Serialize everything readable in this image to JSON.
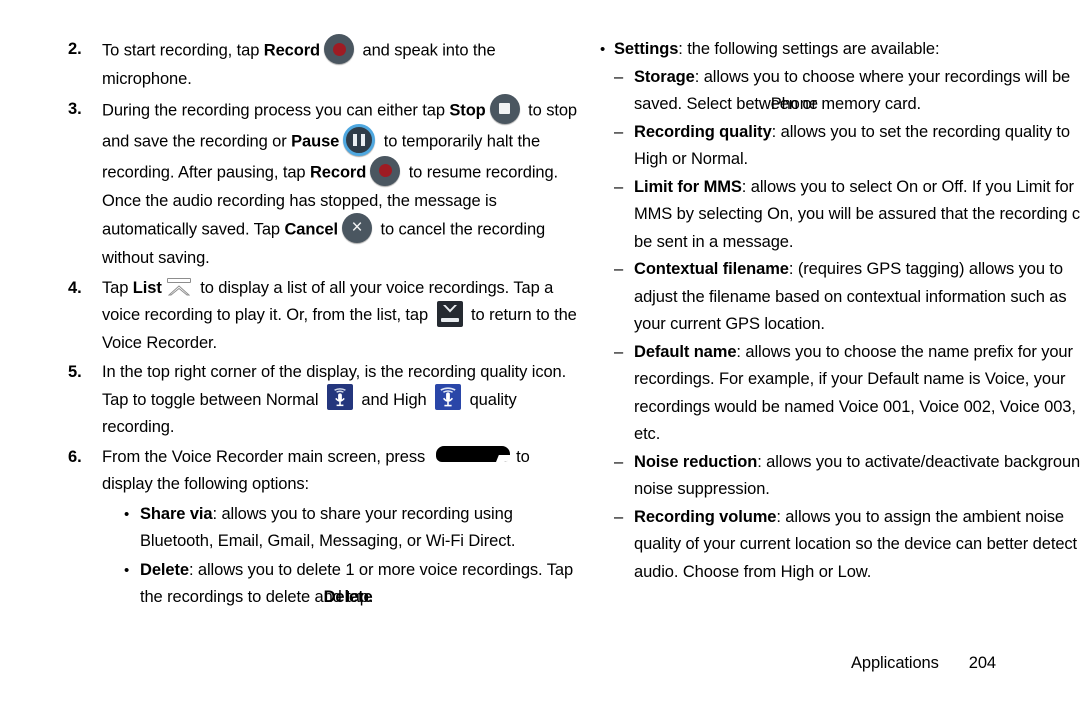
{
  "document": {
    "footer": {
      "section": "Applications",
      "page": "204"
    }
  },
  "left_column": {
    "steps": [
      {
        "number": "2.",
        "text_a": "To start recording, tap ",
        "bold_a": "Record",
        "icon": "record-button-icon",
        "text_b": " and speak into the microphone."
      },
      {
        "number": "3.",
        "text_a": "During the recording process you can either tap ",
        "bold_a": "Stop",
        "icon_a": "stop-button-icon",
        "text_b": " to stop and save the recording or ",
        "bold_b": "Pause",
        "icon_b": "pause-button-icon",
        "text_c": " to temporarily halt the recording. After pausing, tap ",
        "bold_c": "Record",
        "icon_c": "record-button-icon",
        "text_d": " to resume recording. Once the audio recording has stopped, the message is automatically saved. Tap ",
        "bold_d": "Cancel",
        "icon_d": "cancel-button-icon",
        "text_e": " to cancel the recording without saving."
      },
      {
        "number": "4.",
        "text_a": "Tap ",
        "bold_a": "List",
        "icon_a": "list-icon",
        "text_b": " to display a list of all your voice recordings. Tap a voice recording to play it. Or, from the list, tap ",
        "icon_b": "return-icon",
        "text_c": " to return to the Voice Recorder."
      },
      {
        "number": "5.",
        "text_a": "In the top right corner of the display, is the recording quality icon. Tap to toggle between Normal ",
        "icon_a": "mic-normal-quality-icon",
        "text_b": " and High ",
        "icon_b": "mic-high-quality-icon",
        "text_c": " quality recording."
      },
      {
        "number": "6.",
        "text_a": "From the Voice Recorder main screen, press ",
        "icon_a": "menu-key-icon",
        "text_b": " to display the following options:"
      }
    ],
    "options": [
      {
        "bold": "Share via",
        "text": ": allows you to share your recording using Bluetooth, Email, Gmail, Messaging, or Wi-Fi Direct."
      },
      {
        "bold": "Delete",
        "text": ": allows you to delete 1 or more voice recordings. Tap the recordings to delete a",
        "overlap_under": "nd tap",
        "overlap_over": "Delete",
        "text_tail": "."
      }
    ]
  },
  "right_column": {
    "settings_bullet": {
      "bold": "Settings",
      "text": ": the following settings are available:"
    },
    "settings": [
      {
        "bold": "Storage",
        "line1": ": allows you to choose where your recordings will be",
        "line2_pre": "saved. Select betw",
        "overlap_under": "een",
        "overlap_over": "Phone",
        "line2_post": " or memory card."
      },
      {
        "bold": "Recording quality",
        "line1": ": allows you to set the recording quality to",
        "line2": "High or Normal."
      },
      {
        "bold": "Limit for MMS",
        "line1": ": allows you to select On or Off. If you Limit for",
        "line2": "MMS by selecting On, you will be assured that the recording can",
        "line3": "be sent in a message."
      },
      {
        "bold": "Contextual filename",
        "line1": ": (requires GPS tagging) allows you to",
        "line2": "adjust the filename based on contextual information such as",
        "line3": "your current GPS location."
      },
      {
        "bold": "Default name",
        "line1": ": allows you to choose the name prefix for your",
        "line2": "recordings. For example, if your Default name is Voice, your",
        "line3": "recordings would be named Voice 001, Voice 002, Voice 003,",
        "line4": "etc."
      },
      {
        "bold": "Noise reduction",
        "line1": ": allows you to activate/deactivate background",
        "line2": "noise suppression."
      },
      {
        "bold": "Recording volume",
        "line1": ": allows you to assign the ambient noise",
        "line2": "quality of your current location so the device can better detect",
        "line3": "audio. Choose from High or Low."
      }
    ]
  },
  "colors": {
    "button_body": "#4a5660",
    "record_dot": "#9e1b23",
    "pause_ring": "#4fa8e0",
    "mic_normal_bg": "#24367d",
    "mic_high_bg": "#2a46a8",
    "return_bg": "#252a31"
  }
}
